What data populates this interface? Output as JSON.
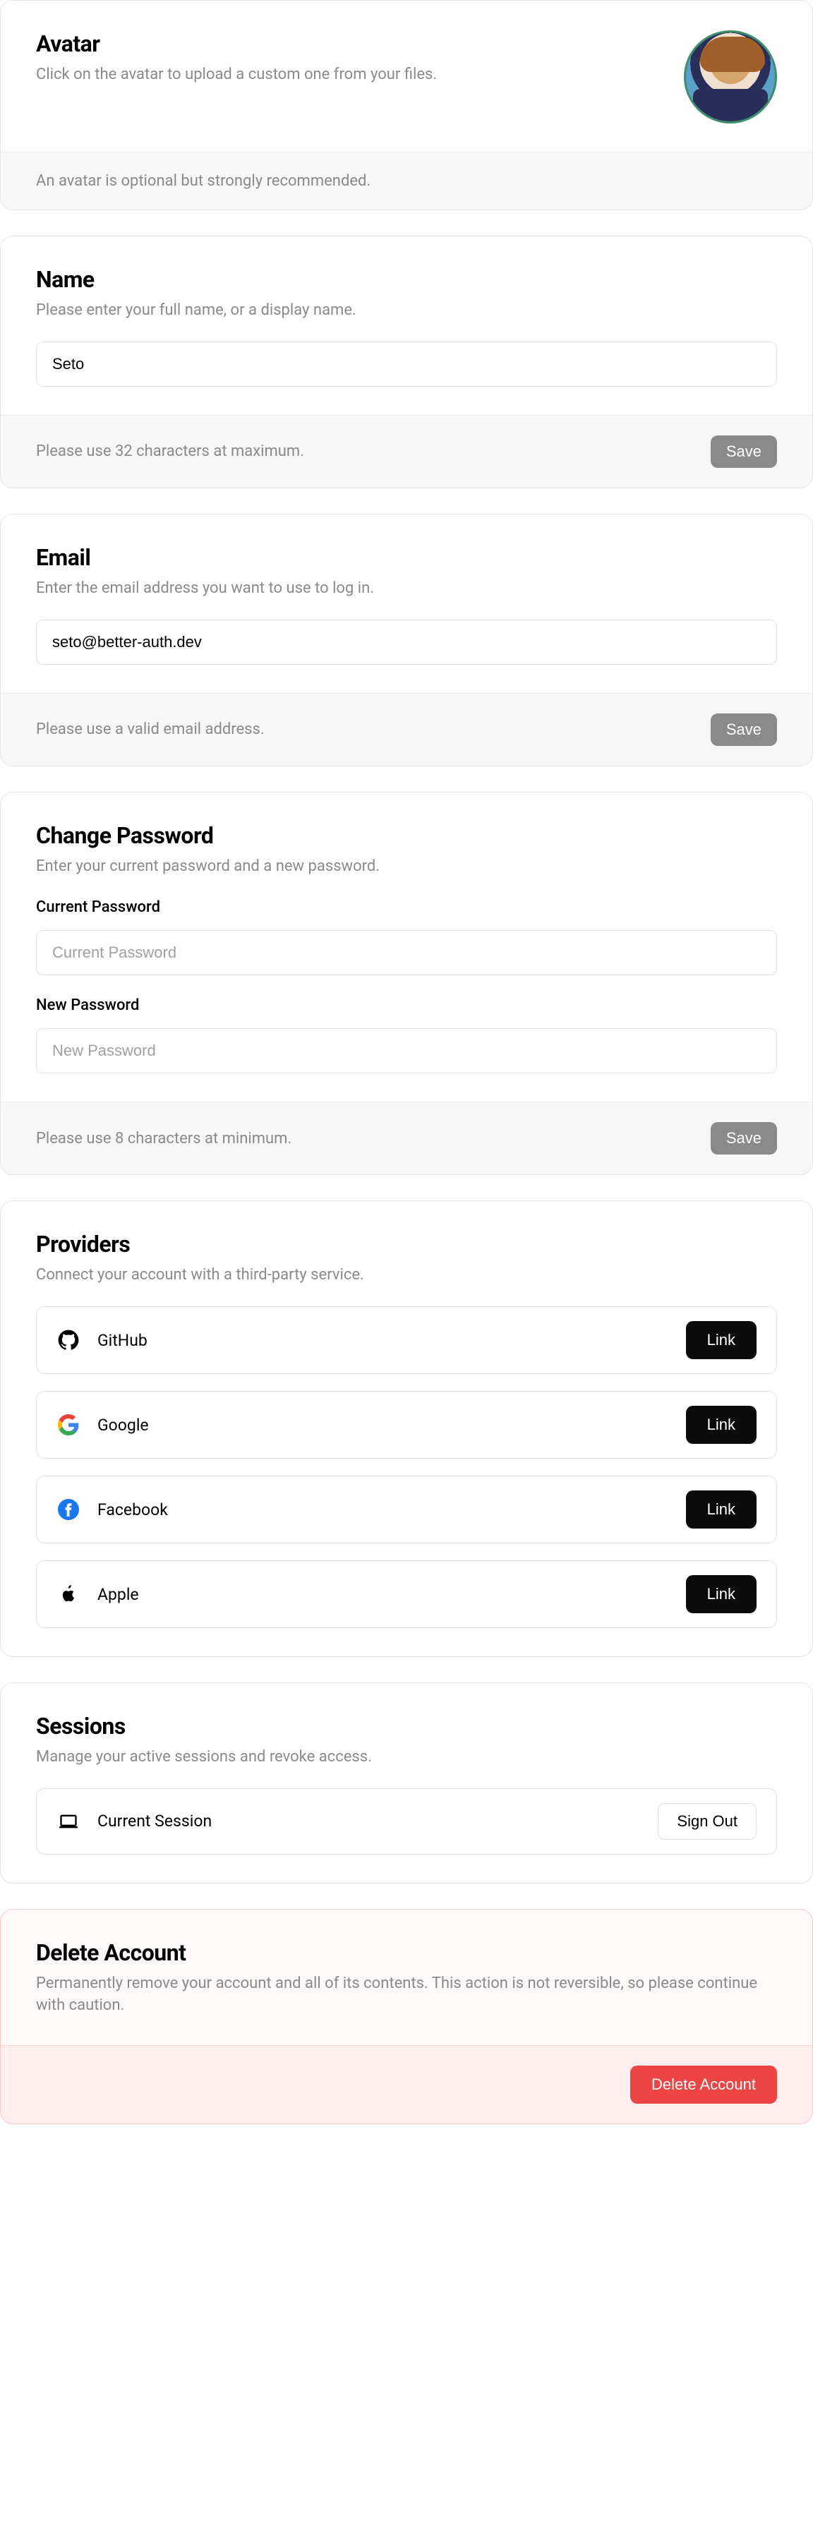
{
  "avatar": {
    "title": "Avatar",
    "desc": "Click on the avatar to upload a custom one from your files.",
    "footer": "An avatar is optional but strongly recommended."
  },
  "name": {
    "title": "Name",
    "desc": "Please enter your full name, or a display name.",
    "value": "Seto",
    "footer": "Please use 32 characters at maximum.",
    "save": "Save"
  },
  "email": {
    "title": "Email",
    "desc": "Enter the email address you want to use to log in.",
    "value": "seto@better-auth.dev",
    "footer": "Please use a valid email address.",
    "save": "Save"
  },
  "password": {
    "title": "Change Password",
    "desc": "Enter your current password and a new password.",
    "current_label": "Current Password",
    "current_placeholder": "Current Password",
    "new_label": "New Password",
    "new_placeholder": "New Password",
    "footer": "Please use 8 characters at minimum.",
    "save": "Save"
  },
  "providers": {
    "title": "Providers",
    "desc": "Connect your account with a third-party service.",
    "link_label": "Link",
    "items": [
      {
        "name": "GitHub",
        "icon": "github-icon"
      },
      {
        "name": "Google",
        "icon": "google-icon"
      },
      {
        "name": "Facebook",
        "icon": "facebook-icon"
      },
      {
        "name": "Apple",
        "icon": "apple-icon"
      }
    ]
  },
  "sessions": {
    "title": "Sessions",
    "desc": "Manage your active sessions and revoke access.",
    "current": "Current Session",
    "signout": "Sign Out"
  },
  "delete": {
    "title": "Delete Account",
    "desc": "Permanently remove your account and all of its contents. This action is not reversible, so please continue with caution.",
    "button": "Delete Account"
  }
}
